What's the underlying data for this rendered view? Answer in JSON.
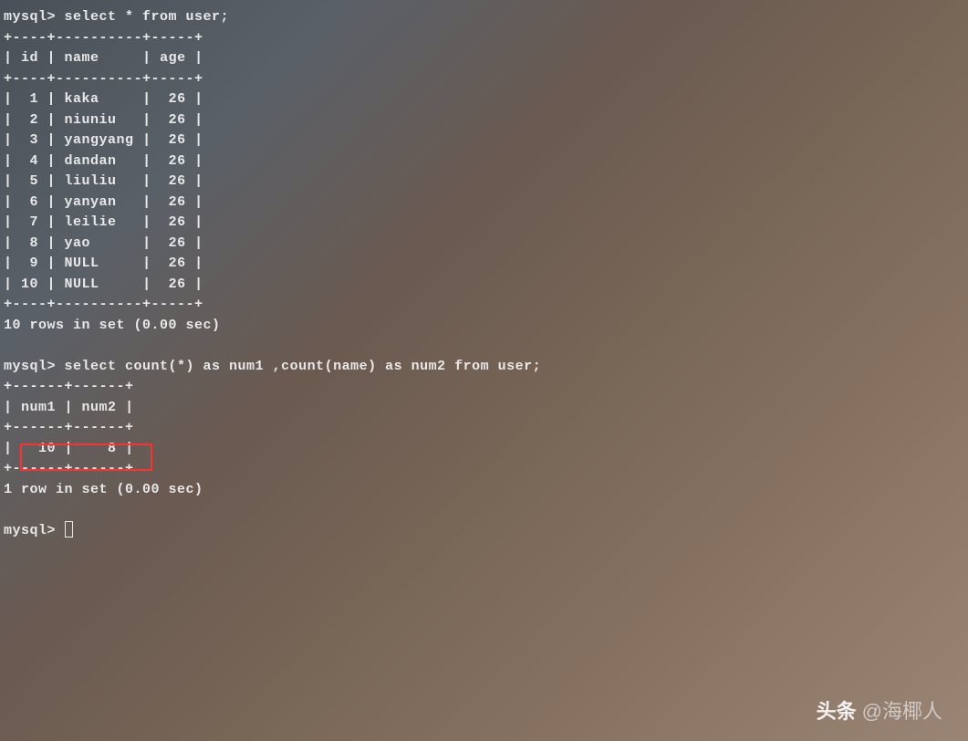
{
  "prompt": "mysql>",
  "query1": {
    "command": "select * from user;",
    "columns": [
      "id",
      "name",
      "age"
    ],
    "rows": [
      {
        "id": "1",
        "name": "kaka",
        "age": "26"
      },
      {
        "id": "2",
        "name": "niuniu",
        "age": "26"
      },
      {
        "id": "3",
        "name": "yangyang",
        "age": "26"
      },
      {
        "id": "4",
        "name": "dandan",
        "age": "26"
      },
      {
        "id": "5",
        "name": "liuliu",
        "age": "26"
      },
      {
        "id": "6",
        "name": "yanyan",
        "age": "26"
      },
      {
        "id": "7",
        "name": "leilie",
        "age": "26"
      },
      {
        "id": "8",
        "name": "yao",
        "age": "26"
      },
      {
        "id": "9",
        "name": "NULL",
        "age": "26"
      },
      {
        "id": "10",
        "name": "NULL",
        "age": "26"
      }
    ],
    "result_msg": "10 rows in set (0.00 sec)"
  },
  "query2": {
    "command": "select count(*) as num1 ,count(name) as num2 from user;",
    "columns": [
      "num1",
      "num2"
    ],
    "rows": [
      {
        "num1": "10",
        "num2": "8"
      }
    ],
    "result_msg": "1 row in set (0.00 sec)"
  },
  "watermark": {
    "label": "头条",
    "user": "@海椰人"
  }
}
